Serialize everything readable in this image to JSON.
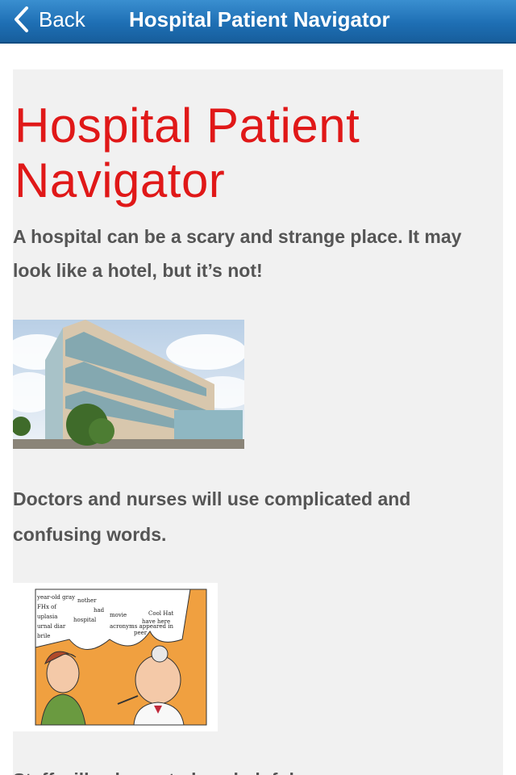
{
  "navbar": {
    "back_label": "Back",
    "title": "Hospital Patient Navigator",
    "color": "#1e6fb4"
  },
  "content": {
    "heading": "Hospital Patient Navigator",
    "heading_color": "#e01818",
    "intro": "A hospital can be a scary and strange place. It may look like a hotel, but it’s not!",
    "doctors_text": "Doctors and nurses will use complicated and confusing words.",
    "staff_text": "Staff will ask you to be a helpful",
    "cartoon_words": [
      "year-old gray",
      "FHx of",
      "uplasia",
      "urnal diar",
      "brile",
      "hospital",
      "nother",
      "had",
      "movie",
      "Cool Hat",
      "acronyms appeared in",
      "have here",
      "peer"
    ]
  },
  "icons": {
    "back": "chevron-left-icon"
  }
}
